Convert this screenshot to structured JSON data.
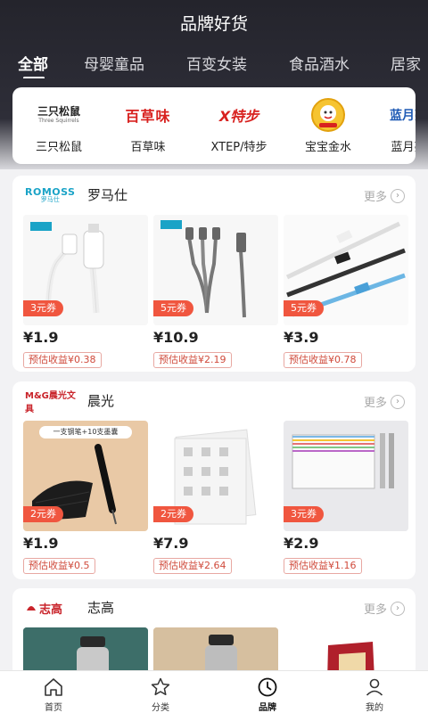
{
  "header": {
    "title": "品牌好货"
  },
  "tabs": [
    {
      "label": "全部"
    },
    {
      "label": "母婴童品"
    },
    {
      "label": "百变女装"
    },
    {
      "label": "食品酒水"
    },
    {
      "label": "居家"
    }
  ],
  "brands": [
    {
      "name": "三只松鼠",
      "logo_text": "三只松鼠"
    },
    {
      "name": "百草味",
      "logo_text": "百草味"
    },
    {
      "name": "XTEP/特步",
      "logo_text": "X特步"
    },
    {
      "name": "宝宝金水",
      "logo_text": ""
    },
    {
      "name": "蓝月亮",
      "logo_text": "蓝月亮"
    }
  ],
  "more_label": "更多",
  "shops": [
    {
      "name": "罗马仕",
      "logo_text": "ROMOSS",
      "logo_subtext": "罗马仕",
      "products": [
        {
          "coupon": "3元券",
          "price": "¥1.9",
          "earn": "预估收益¥0.38"
        },
        {
          "coupon": "5元券",
          "price": "¥10.9",
          "earn": "预估收益¥2.19"
        },
        {
          "coupon": "5元券",
          "price": "¥3.9",
          "earn": "预估收益¥0.78"
        }
      ]
    },
    {
      "name": "晨光",
      "logo_text": "M&G晨光文具",
      "logo_subtext": "",
      "products": [
        {
          "coupon": "2元券",
          "price": "¥1.9",
          "earn": "预估收益¥0.5",
          "banner": "一支钢笔+10支墨囊"
        },
        {
          "coupon": "2元券",
          "price": "¥7.9",
          "earn": "预估收益¥2.64"
        },
        {
          "coupon": "3元券",
          "price": "¥2.9",
          "earn": "预估收益¥1.16"
        }
      ]
    },
    {
      "name": "志高",
      "logo_text": "志高",
      "logo_subtext": "",
      "products": [
        {},
        {},
        {}
      ]
    }
  ],
  "tabbar": [
    {
      "label": "首页",
      "icon": "home-icon"
    },
    {
      "label": "分类",
      "icon": "star-icon"
    },
    {
      "label": "品牌",
      "icon": "clock-icon"
    },
    {
      "label": "我的",
      "icon": "user-icon"
    }
  ],
  "colors": {
    "coupon": "#f0563f",
    "earn_text": "#d04b3c",
    "header_dark": "#24242c"
  }
}
